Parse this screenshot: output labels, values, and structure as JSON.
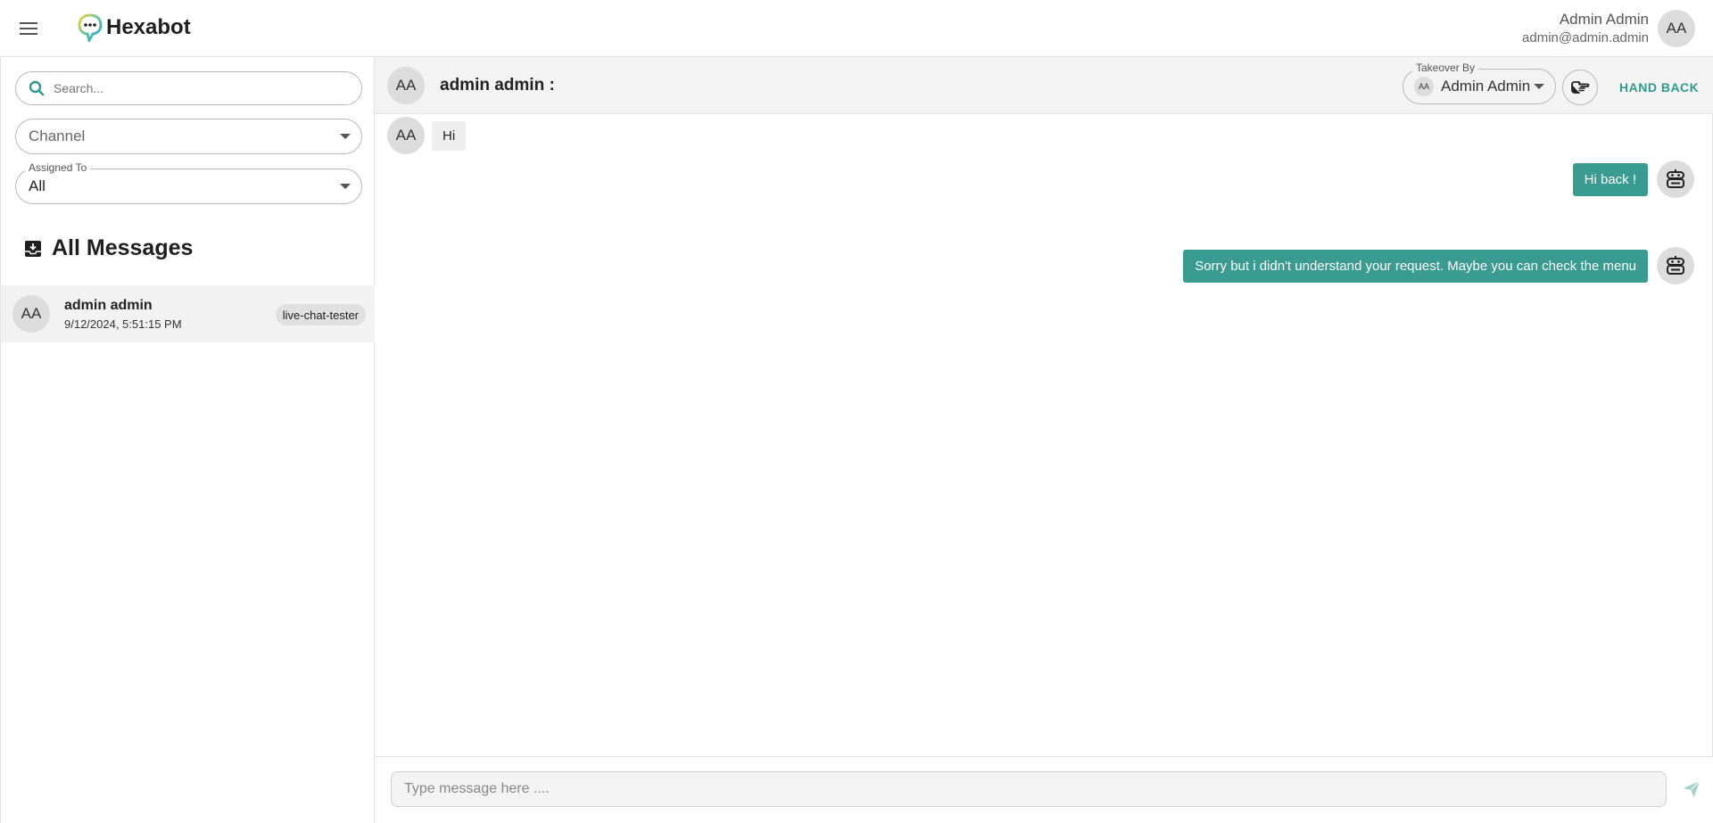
{
  "header": {
    "app_name": "Hexabot",
    "user": {
      "name": "Admin Admin",
      "email": "admin@admin.admin",
      "initials": "AA"
    },
    "menu_icon": "hamburger-icon",
    "logo_icon": "chat-bubble-logo-icon"
  },
  "sidebar": {
    "search_placeholder": "Search...",
    "channel_label": "Channel",
    "assigned_to_label": "Assigned To",
    "assigned_to_value": "All",
    "section_title": "All Messages",
    "section_icon": "inbox-icon",
    "conversations": [
      {
        "initials": "AA",
        "name": "admin admin",
        "date": "9/12/2024, 5:51:15 PM",
        "channel": "live-chat-tester"
      }
    ]
  },
  "chat": {
    "header": {
      "initials": "AA",
      "title": "admin admin :",
      "takeover_label": "Takeover By",
      "takeover_initials": "AA",
      "takeover_name": "Admin Admin",
      "assign_icon": "hand-pointing-icon",
      "hand_back_label": "HAND BACK"
    },
    "messages": [
      {
        "direction": "in",
        "initials": "AA",
        "text": "Hi"
      },
      {
        "direction": "out",
        "text": "Hi back !",
        "avatar_icon": "robot-icon"
      },
      {
        "direction": "out",
        "text": "Sorry but i didn't understand your request. Maybe you can check the menu",
        "avatar_icon": "robot-icon"
      }
    ],
    "composer_placeholder": "Type message here ....",
    "send_icon": "send-icon"
  },
  "colors": {
    "accent": "#3a9b90",
    "accent_text": "#2f9b90",
    "avatar_bg": "#dcdcdc"
  }
}
